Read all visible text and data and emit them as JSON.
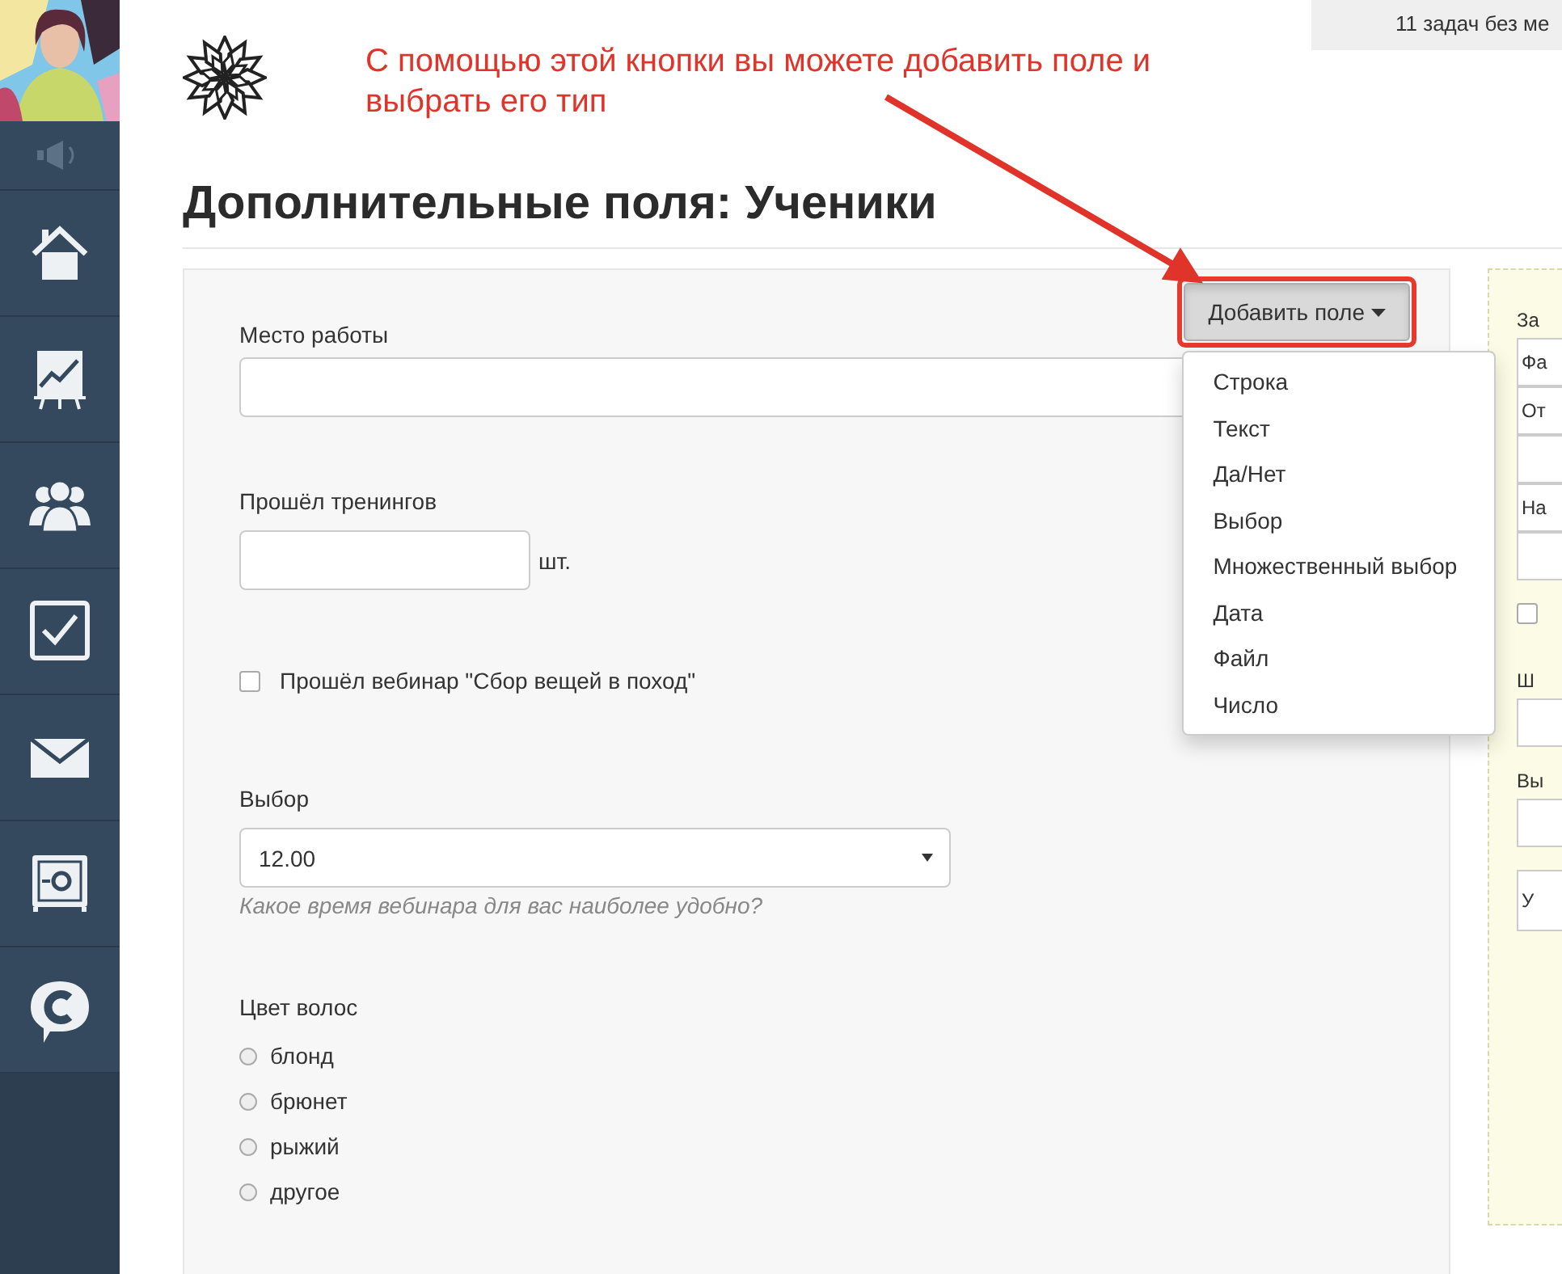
{
  "top_bar": {
    "notice": "11 задач без ме"
  },
  "page_title": "Дополнительные поля: Ученики",
  "annotation": {
    "text": "С помощью этой кнопки вы можете добавить поле и выбрать его тип"
  },
  "add_field_button": {
    "label": "Добавить поле",
    "expanded": true,
    "menu": [
      "Строка",
      "Текст",
      "Да/Нет",
      "Выбор",
      "Множественный выбор",
      "Дата",
      "Файл",
      "Число"
    ]
  },
  "form": {
    "fields": [
      {
        "kind": "text",
        "label": "Место работы"
      },
      {
        "kind": "number",
        "label": "Прошёл тренингов",
        "unit": "шт."
      },
      {
        "kind": "checkbox",
        "label": "Прошёл вебинар \"Сбор вещей в поход\"",
        "checked": false
      },
      {
        "kind": "select",
        "label": "Выбор",
        "value": "12.00",
        "hint": "Какое время вебинара для вас наиболее удобно?"
      },
      {
        "kind": "radio",
        "label": "Цвет волос",
        "options": [
          {
            "label": "блонд",
            "selected": false
          },
          {
            "label": "брюнет",
            "selected": false
          },
          {
            "label": "рыжий",
            "selected": false
          },
          {
            "label": "другое",
            "selected": false
          }
        ]
      }
    ]
  },
  "right_panel": {
    "items": [
      {
        "kind": "label",
        "text": "За"
      },
      {
        "kind": "input",
        "text": "Фа"
      },
      {
        "kind": "input",
        "text": "От"
      },
      {
        "kind": "input"
      },
      {
        "kind": "input",
        "text": "На"
      },
      {
        "kind": "input"
      },
      {
        "kind": "checkbox",
        "checked": false
      },
      {
        "kind": "label",
        "text": "Ш"
      },
      {
        "kind": "input"
      },
      {
        "kind": "label",
        "text": "Вы"
      },
      {
        "kind": "input"
      },
      {
        "kind": "select",
        "text": "У"
      }
    ]
  }
}
